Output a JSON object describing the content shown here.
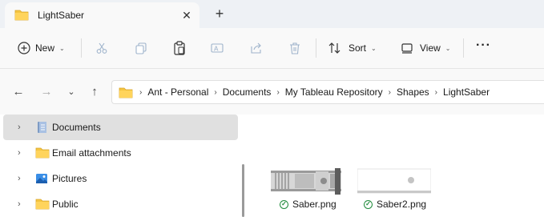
{
  "window": {
    "tab_title": "LightSaber",
    "close_glyph": "✕",
    "new_tab_glyph": "+"
  },
  "toolbar": {
    "new_label": "New",
    "sort_label": "Sort",
    "view_label": "View",
    "more_glyph": "···"
  },
  "address": {
    "crumbs": [
      "Ant - Personal",
      "Documents",
      "My Tableau Repository",
      "Shapes",
      "LightSaber"
    ]
  },
  "sidebar": {
    "items": [
      {
        "label": "Documents",
        "icon": "documents-icon",
        "selected": true
      },
      {
        "label": "Email attachments",
        "icon": "folder-icon",
        "selected": false
      },
      {
        "label": "Pictures",
        "icon": "pictures-icon",
        "selected": false
      },
      {
        "label": "Public",
        "icon": "folder-icon",
        "selected": false
      }
    ]
  },
  "files": [
    {
      "name": "Saber.png",
      "status": "synced"
    },
    {
      "name": "Saber2.png",
      "status": "synced"
    }
  ],
  "colors": {
    "folder": "#f5c542",
    "sync_green": "#1e8a3a",
    "accent": "#0067c0"
  }
}
